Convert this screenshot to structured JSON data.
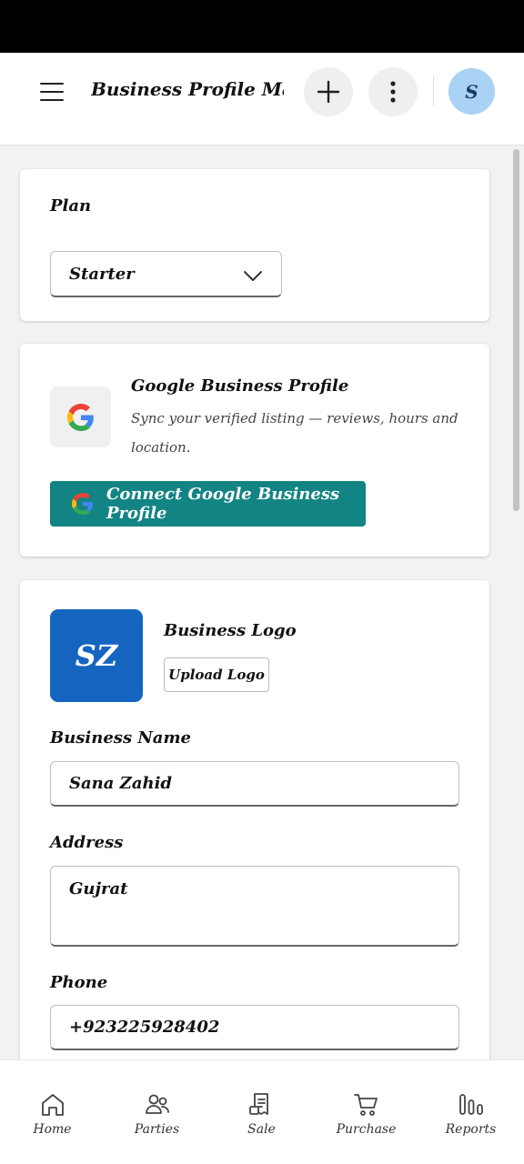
{
  "header": {
    "title": "Business Profile Man.",
    "avatar_initial": "S"
  },
  "plan_card": {
    "label": "Plan",
    "selected": "Starter"
  },
  "google_card": {
    "title": "Google Business Profile",
    "description": "Sync your verified listing — reviews, hours and location.",
    "connect_label": "Connect Google Business Profile"
  },
  "business_card": {
    "logo_initials": "SZ",
    "logo_title": "Business Logo",
    "upload_label": "Upload Logo",
    "name_label": "Business Name",
    "name_value": "Sana Zahid",
    "address_label": "Address",
    "address_value": "Gujrat",
    "phone_label": "Phone",
    "phone_value": "+923225928402"
  },
  "bottom_nav": {
    "items": [
      {
        "label": "Home",
        "icon": "home-icon"
      },
      {
        "label": "Parties",
        "icon": "users-icon"
      },
      {
        "label": "Sale",
        "icon": "receipt-icon"
      },
      {
        "label": "Purchase",
        "icon": "cart-icon"
      },
      {
        "label": "Reports",
        "icon": "bars-icon"
      }
    ]
  },
  "colors": {
    "accent": "#138484",
    "logo_bg": "#1565c0",
    "avatar_bg": "#a9d2f5"
  }
}
